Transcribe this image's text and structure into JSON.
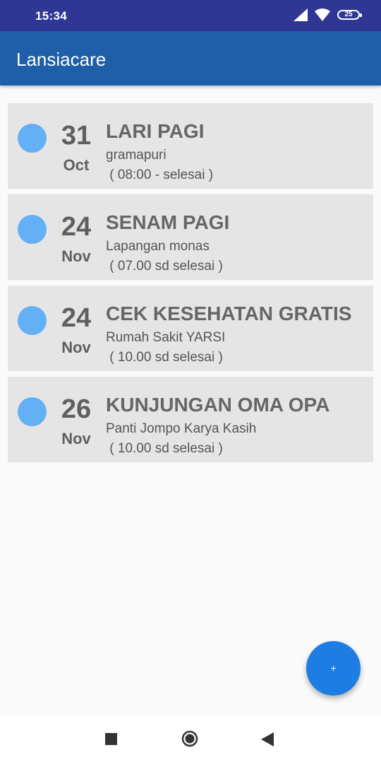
{
  "status_bar": {
    "time": "15:34",
    "battery": "25"
  },
  "app_bar": {
    "title": "Lansiacare"
  },
  "colors": {
    "status_bar": "#2f3694",
    "app_bar": "#1f5ea8",
    "dot": "#64b0f6",
    "fab": "#1e7de3",
    "card": "#e5e5e5"
  },
  "events": [
    {
      "day": "31",
      "month": "Oct",
      "title": "LARI PAGI",
      "location": "gramapuri",
      "time": " ( 08:00 - selesai )"
    },
    {
      "day": "24",
      "month": "Nov",
      "title": "SENAM PAGI",
      "location": "Lapangan monas",
      "time": " ( 07.00 sd selesai )"
    },
    {
      "day": "24",
      "month": "Nov",
      "title": "CEK KESEHATAN GRATIS",
      "location": "Rumah Sakit YARSI",
      "time": " ( 10.00 sd selesai )"
    },
    {
      "day": "26",
      "month": "Nov",
      "title": "KUNJUNGAN OMA OPA",
      "location": "Panti Jompo Karya Kasih",
      "time": " ( 10.00 sd selesai )"
    }
  ],
  "fab": {
    "label": "+",
    "icon": "add-icon"
  },
  "nav_bar": {
    "icons": [
      "recents-icon",
      "home-icon",
      "back-icon"
    ]
  }
}
